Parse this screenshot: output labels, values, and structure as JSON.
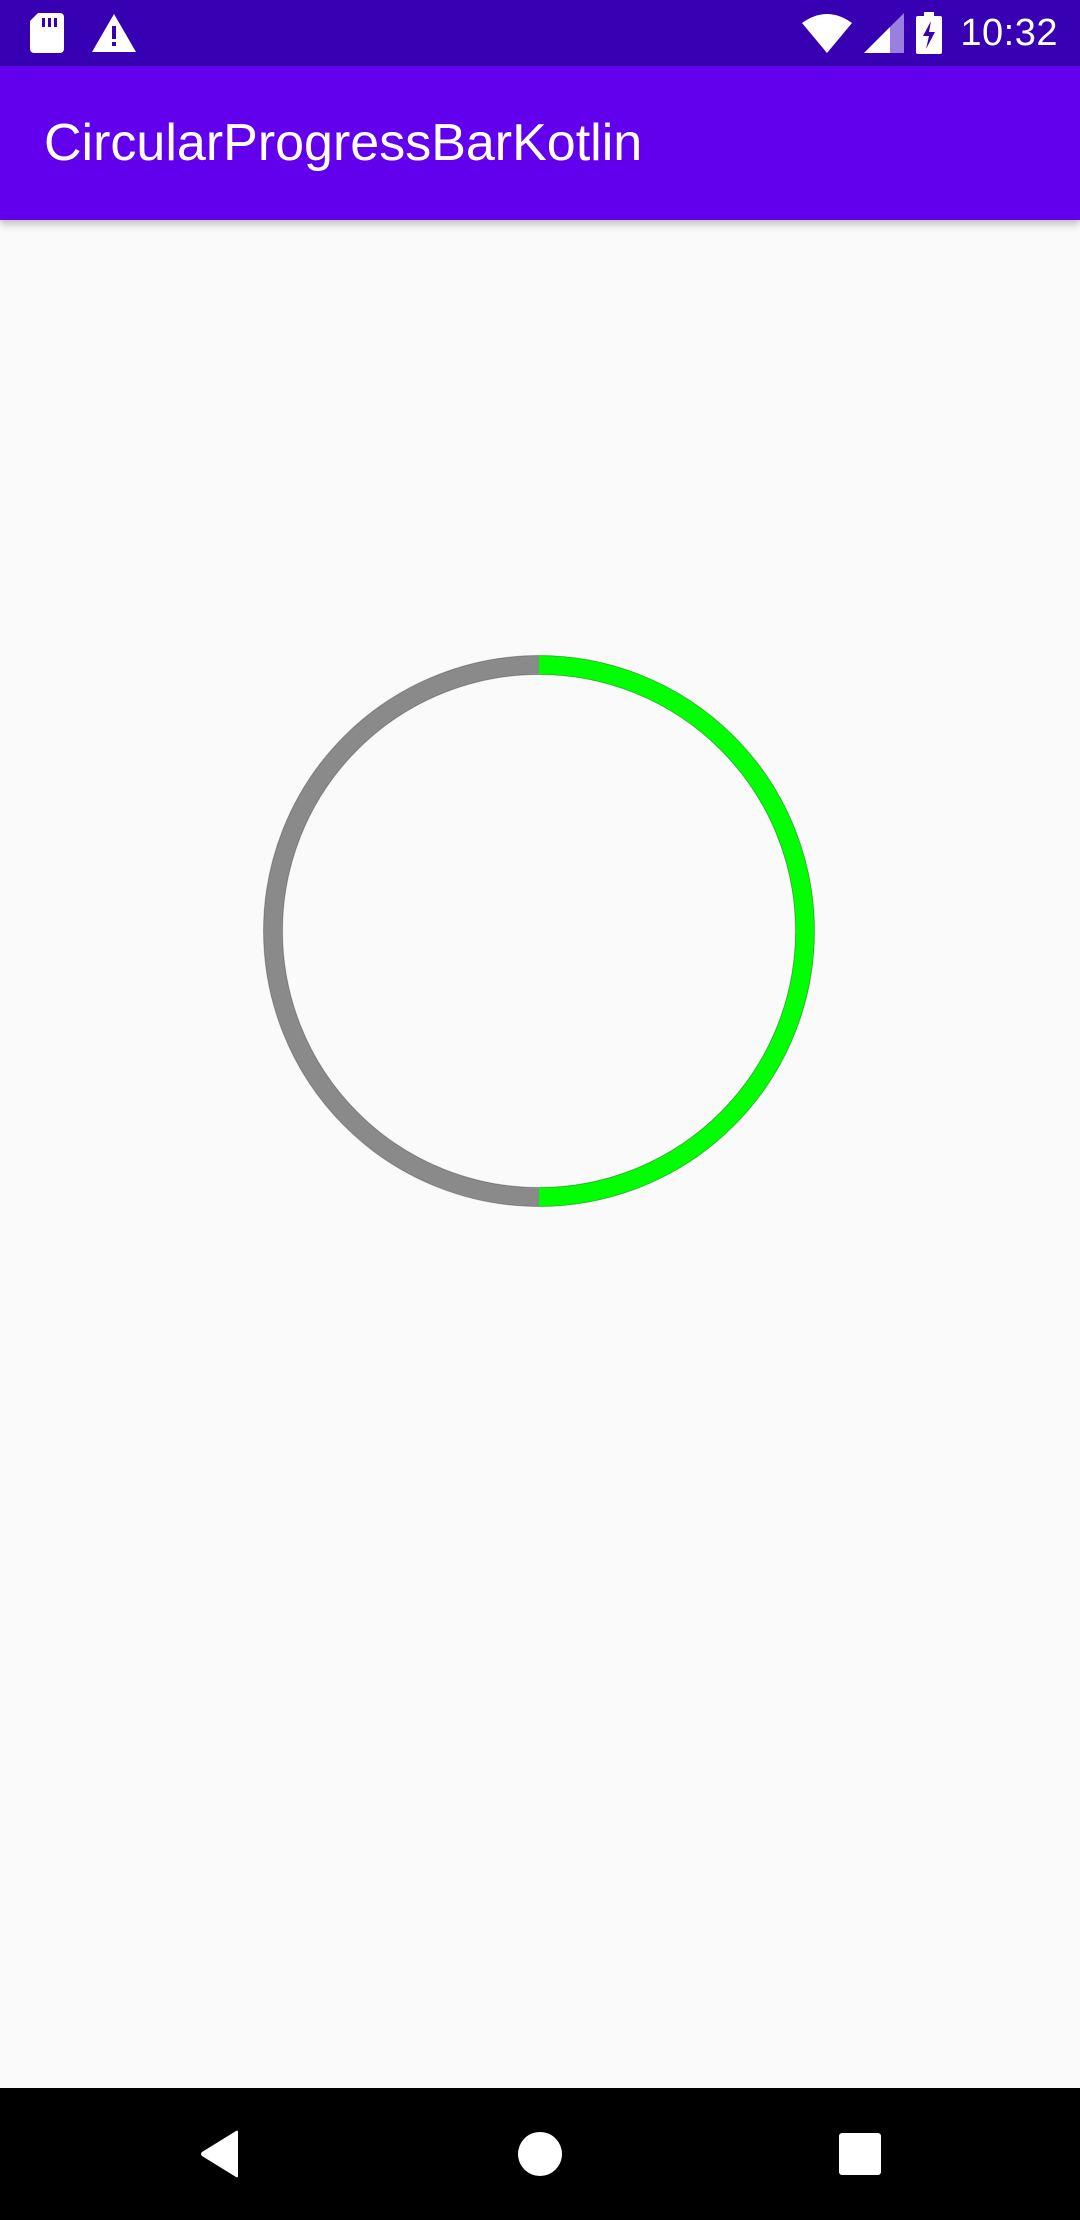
{
  "status_bar": {
    "time": "10:32",
    "icons": [
      "sd-card-icon",
      "warning-icon",
      "wifi-icon",
      "cellular-signal-icon",
      "battery-charging-icon"
    ]
  },
  "app_bar": {
    "title": "CircularProgressBarKotlin"
  },
  "progress": {
    "value": 0.5,
    "track_color": "#8a8a8a",
    "progress_color": "#00ff00",
    "start_position": "top",
    "direction": "clockwise"
  },
  "nav_bar": {
    "buttons": [
      "back-icon",
      "home-icon",
      "recents-icon"
    ]
  },
  "colors": {
    "status_bar": "#3700b3",
    "app_bar": "#6200ee",
    "background": "#fafafa",
    "nav_bar": "#000000"
  }
}
